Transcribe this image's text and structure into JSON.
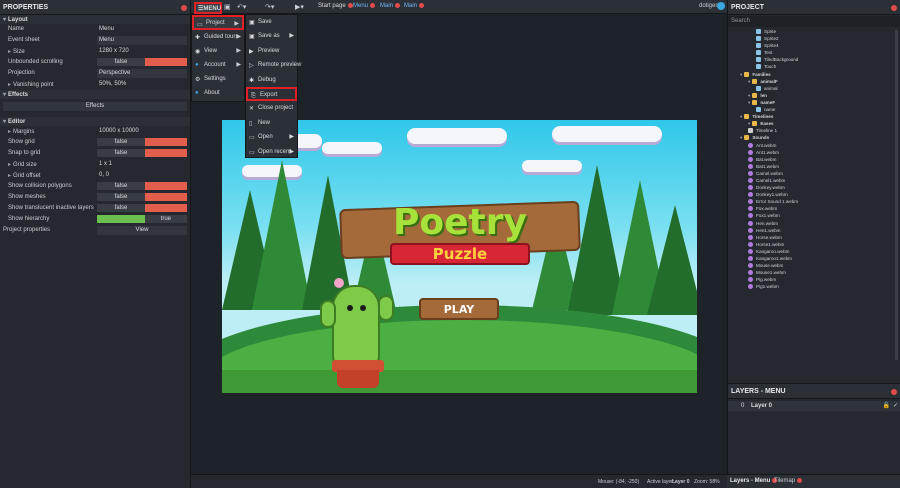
{
  "properties": {
    "title": "PROPERTIES",
    "layout": {
      "header": "Layout",
      "name_label": "Name",
      "name_value": "Menu",
      "eventsheet_label": "Event sheet",
      "eventsheet_value": "Menu",
      "size_label": "Size",
      "size_value": "1280 x 720",
      "unbounded_label": "Unbounded scrolling",
      "unbounded_value": "false",
      "projection_label": "Projection",
      "projection_value": "Perspective",
      "vanishing_label": "Vanishing point",
      "vanishing_value": "50%, 50%"
    },
    "effects": {
      "header": "Effects",
      "button": "Effects"
    },
    "editor": {
      "header": "Editor",
      "margins_label": "Margins",
      "margins_value": "10000 x 10000",
      "showgrid_label": "Show grid",
      "showgrid_value": "false",
      "snap_label": "Snap to grid",
      "snap_value": "false",
      "gridsize_label": "Grid size",
      "gridsize_value": "1 x 1",
      "gridoffset_label": "Grid offset",
      "gridoffset_value": "0, 0",
      "collision_label": "Show collision polygons",
      "collision_value": "false",
      "meshes_label": "Show meshes",
      "meshes_value": "false",
      "translucent_label": "Show translucent inactive layers",
      "translucent_value": "false",
      "hierarchy_label": "Show hierarchy",
      "hierarchy_value": "true"
    },
    "project_props_label": "Project properties",
    "project_props_button": "View"
  },
  "topbar": {
    "menu_label": "MENU",
    "tabs": [
      "Start page",
      "Menu",
      "Main",
      "Main"
    ],
    "user": "dotigen"
  },
  "main_menu": [
    "Project",
    "Guided tours",
    "View",
    "Account",
    "Settings",
    "About"
  ],
  "project_submenu": [
    "Save",
    "Save as",
    "Preview",
    "Remote preview",
    "Debug",
    "Export",
    "Close project",
    "New",
    "Open",
    "Open recent"
  ],
  "game": {
    "title_line1": "Poetry",
    "title_line2": "Puzzle",
    "play_button": "PLAY"
  },
  "statusbar": {
    "mouse": "Mouse: (-84, -250)",
    "active_layer_label": "Active layer:",
    "active_layer_value": "Layer 0",
    "zoom": "Zoom: 58%"
  },
  "project_panel": {
    "title": "PROJECT",
    "search_placeholder": "Search",
    "items": [
      {
        "name": "Sprite",
        "kind": "sprite",
        "indent": 2
      },
      {
        "name": "Sprite2",
        "kind": "sprite",
        "indent": 2
      },
      {
        "name": "Sprite4",
        "kind": "sprite",
        "indent": 2
      },
      {
        "name": "Text",
        "kind": "sprite",
        "indent": 2
      },
      {
        "name": "TiledBackground",
        "kind": "sprite",
        "indent": 2
      },
      {
        "name": "Touch",
        "kind": "sprite",
        "indent": 2
      },
      {
        "name": "Families",
        "kind": "folder",
        "indent": 0
      },
      {
        "name": "animalF",
        "kind": "folder",
        "indent": 1
      },
      {
        "name": "animal",
        "kind": "sprite",
        "indent": 2
      },
      {
        "name": "len",
        "kind": "folder",
        "indent": 1
      },
      {
        "name": "nameF",
        "kind": "folder",
        "indent": 1
      },
      {
        "name": "name",
        "kind": "sprite",
        "indent": 2
      },
      {
        "name": "Timelines",
        "kind": "folder",
        "indent": 0
      },
      {
        "name": "Eases",
        "kind": "folder",
        "indent": 1
      },
      {
        "name": "Timeline 1",
        "kind": "tl",
        "indent": 1
      },
      {
        "name": "Sounds",
        "kind": "folder",
        "indent": 0
      },
      {
        "name": "Ant.webm",
        "kind": "sound",
        "indent": 1
      },
      {
        "name": "Ant1.webm",
        "kind": "sound",
        "indent": 1
      },
      {
        "name": "Bat.webm",
        "kind": "sound",
        "indent": 1
      },
      {
        "name": "Bat1.webm",
        "kind": "sound",
        "indent": 1
      },
      {
        "name": "Camel.webm",
        "kind": "sound",
        "indent": 1
      },
      {
        "name": "Camel1.webm",
        "kind": "sound",
        "indent": 1
      },
      {
        "name": "Donkey.webm",
        "kind": "sound",
        "indent": 1
      },
      {
        "name": "Donkey1.webm",
        "kind": "sound",
        "indent": 1
      },
      {
        "name": "Error Sound 1.webm",
        "kind": "sound",
        "indent": 1
      },
      {
        "name": "Fox.webm",
        "kind": "sound",
        "indent": 1
      },
      {
        "name": "Fox1.webm",
        "kind": "sound",
        "indent": 1
      },
      {
        "name": "Hen.webm",
        "kind": "sound",
        "indent": 1
      },
      {
        "name": "Hen1.webm",
        "kind": "sound",
        "indent": 1
      },
      {
        "name": "Horse.webm",
        "kind": "sound",
        "indent": 1
      },
      {
        "name": "Horse1.webm",
        "kind": "sound",
        "indent": 1
      },
      {
        "name": "Kangaroo.webm",
        "kind": "sound",
        "indent": 1
      },
      {
        "name": "Kangaroo1.webm",
        "kind": "sound",
        "indent": 1
      },
      {
        "name": "Mouse.webm",
        "kind": "sound",
        "indent": 1
      },
      {
        "name": "Mouse1.webm",
        "kind": "sound",
        "indent": 1
      },
      {
        "name": "Pig.webm",
        "kind": "sound",
        "indent": 1
      },
      {
        "name": "Pig1.webm",
        "kind": "sound",
        "indent": 1
      }
    ]
  },
  "layers_panel": {
    "title": "LAYERS - MENU",
    "layer_index": "0",
    "layer_name": "Layer 0"
  },
  "bottom_tabs": [
    "Layers - Menu",
    "Tilemap"
  ],
  "colors": {
    "accent_red": "#e01f26",
    "false_red": "#e35f4c",
    "true_green": "#6bbf4e"
  }
}
